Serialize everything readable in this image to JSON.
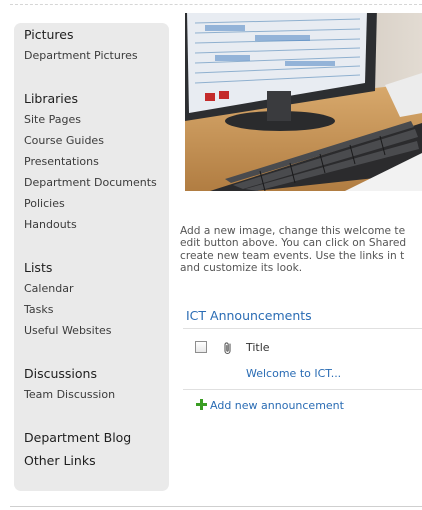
{
  "quick_launch": {
    "sections": [
      {
        "heading": "Pictures",
        "items": [
          "Department Pictures"
        ]
      },
      {
        "heading": "Libraries",
        "items": [
          "Site Pages",
          "Course Guides",
          "Presentations",
          "Department Documents",
          "Policies",
          "Handouts"
        ]
      },
      {
        "heading": "Lists",
        "items": [
          "Calendar",
          "Tasks",
          "Useful Websites"
        ]
      },
      {
        "heading": "Discussions",
        "items": [
          "Team Discussion"
        ]
      }
    ],
    "department_blog": "Department Blog",
    "other_links": "Other Links"
  },
  "welcome_text": [
    "Add a new image, change this welcome te",
    "edit button above. You can click on Shared",
    "create new team events. Use the links in t",
    "and customize its look."
  ],
  "announcements": {
    "title": "ICT Announcements",
    "column_title": "Title",
    "rows": [
      "Welcome to ICT..."
    ],
    "add_new": "Add new announcement"
  },
  "colors": {
    "link": "#2a6cb4",
    "panel": "#eaeaea",
    "add_icon": "#3a9d23"
  },
  "icons": {
    "attachment": "paperclip-icon",
    "add": "plus-icon"
  }
}
